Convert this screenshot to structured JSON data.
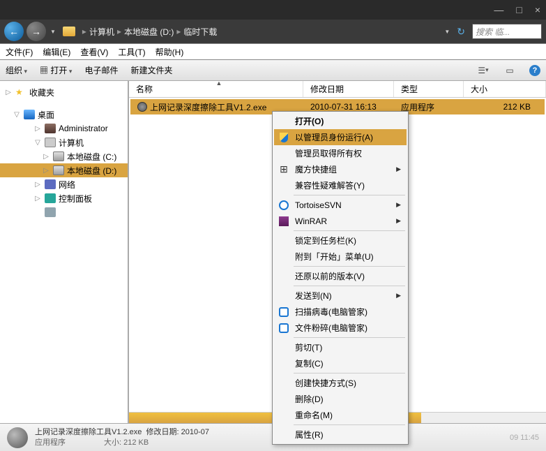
{
  "titlebar": {
    "min": "—",
    "max": "□",
    "close": "×"
  },
  "breadcrumb": {
    "computer": "计算机",
    "drive": "本地磁盘 (D:)",
    "folder": "临时下载"
  },
  "search": {
    "placeholder": "搜索 临..."
  },
  "menubar": {
    "file": "文件(F)",
    "edit": "编辑(E)",
    "view": "查看(V)",
    "tools": "工具(T)",
    "help": "帮助(H)"
  },
  "toolbar": {
    "organize": "组织",
    "open": "打开",
    "email": "电子邮件",
    "new_folder": "新建文件夹"
  },
  "sidebar": {
    "favorites": "收藏夹",
    "desktop": "桌面",
    "admin": "Administrator",
    "computer": "计算机",
    "drive_c": "本地磁盘 (C:)",
    "drive_d": "本地磁盘 (D:)",
    "network": "网络",
    "control_panel": "控制面板",
    "recycle": ""
  },
  "columns": {
    "name": "名称",
    "date": "修改日期",
    "type": "类型",
    "size": "大小"
  },
  "file": {
    "name": "上网记录深度擦除工具V1.2.exe",
    "date": "2010-07-31 16:13",
    "type": "应用程序",
    "size": "212 KB"
  },
  "context": {
    "open": "打开(O)",
    "run_as_admin": "以管理员身份运行(A)",
    "admin_ownership": "管理员取得所有权",
    "mofang": "魔方快捷组",
    "compat": "兼容性疑难解答(Y)",
    "svn": "TortoiseSVN",
    "winrar": "WinRAR",
    "pin_taskbar": "锁定到任务栏(K)",
    "pin_start": "附到「开始」菜单(U)",
    "restore": "还原以前的版本(V)",
    "send_to": "发送到(N)",
    "scan": "扫描病毒(电脑管家)",
    "shred": "文件粉碎(电脑管家)",
    "cut": "剪切(T)",
    "copy": "复制(C)",
    "shortcut": "创建快捷方式(S)",
    "delete": "删除(D)",
    "rename": "重命名(M)",
    "properties": "属性(R)"
  },
  "status": {
    "line1_name": "上网记录深度擦除工具V1.2.exe",
    "line1_date_lbl": "修改日期:",
    "line1_date": "2010-07",
    "line1_tail": "09 11:45",
    "line2_type": "应用程序",
    "line2_size_lbl": "大小:",
    "line2_size": "212 KB"
  }
}
